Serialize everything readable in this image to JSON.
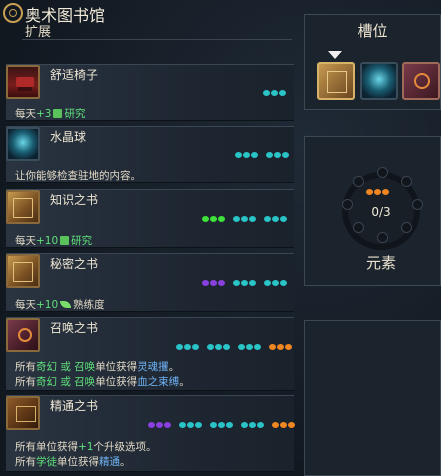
{
  "header": {
    "title": "奥术图书馆",
    "subtitle": "扩展"
  },
  "items": [
    {
      "name": "舒适椅子",
      "desc": [
        "每天",
        "+3",
        "研究"
      ]
    },
    {
      "name": "水晶球",
      "desc": [
        "让你能够检查驻地的内容。"
      ]
    },
    {
      "name": "知识之书",
      "desc": [
        "每天",
        "+10",
        "研究"
      ]
    },
    {
      "name": "秘密之书",
      "desc": [
        "每天",
        "+10",
        "熟练度"
      ]
    },
    {
      "name": "召唤之书",
      "desc": [
        [
          "所有",
          "奇幻",
          "或",
          "召唤",
          "单位获得",
          "灵魂攫"
        ],
        [
          "所有",
          "奇幻",
          "或",
          "召唤",
          "单位获得",
          "血之束缚"
        ]
      ]
    },
    {
      "name": "精通之书",
      "desc": [
        [
          "所有单位获得",
          "+1",
          "个升级选项。"
        ],
        [
          "所有",
          "学徒",
          "单位获得",
          "精通"
        ]
      ]
    }
  ],
  "slots": {
    "title": "槽位",
    "icons": [
      "book-of-knowledge-icon",
      "crystal-ball-icon",
      "book-of-summoning-icon"
    ]
  },
  "elements": {
    "count": "0/3",
    "label": "元素"
  },
  "colors": {
    "teal": "#2ac3c8",
    "green": "#3fe23a",
    "purple": "#8a3fe0",
    "orange": "#f08620",
    "highlight_green": "#5fe07a",
    "highlight_blue": "#6fb3f5"
  }
}
